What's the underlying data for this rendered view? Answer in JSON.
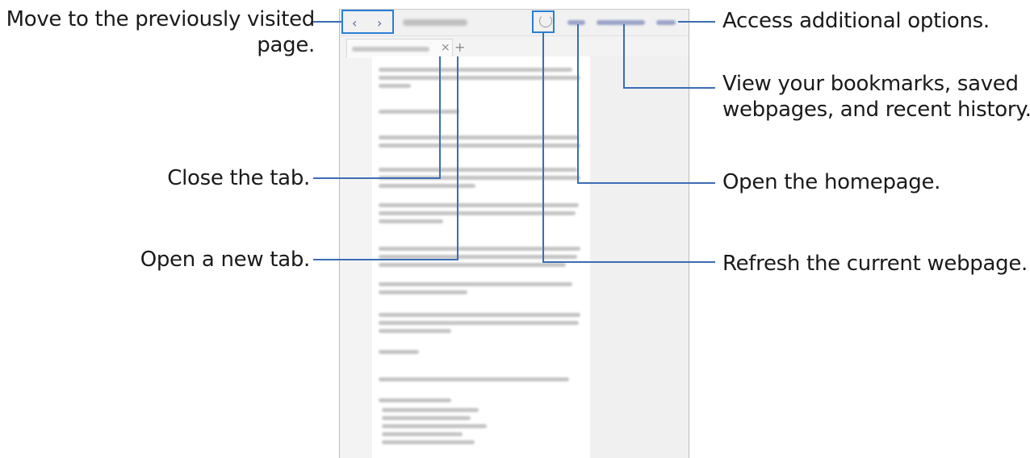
{
  "callouts": {
    "back_forward": [
      "Move to the previously visited",
      "page."
    ],
    "close_tab": "Close the tab.",
    "new_tab": "Open a new tab.",
    "more": "Access additional options.",
    "bookmarks": [
      "View your bookmarks, saved",
      "webpages, and recent history."
    ],
    "home": "Open the homepage.",
    "refresh": "Refresh the current webpage."
  },
  "browser": {
    "back_icon": "‹",
    "forward_icon": "›",
    "close_tab_icon": "×",
    "new_tab_icon": "+"
  },
  "colors": {
    "callout_line": "#3b6db4",
    "highlight_box": "#2a7fd6",
    "menu_text": "#9aa3c8"
  }
}
